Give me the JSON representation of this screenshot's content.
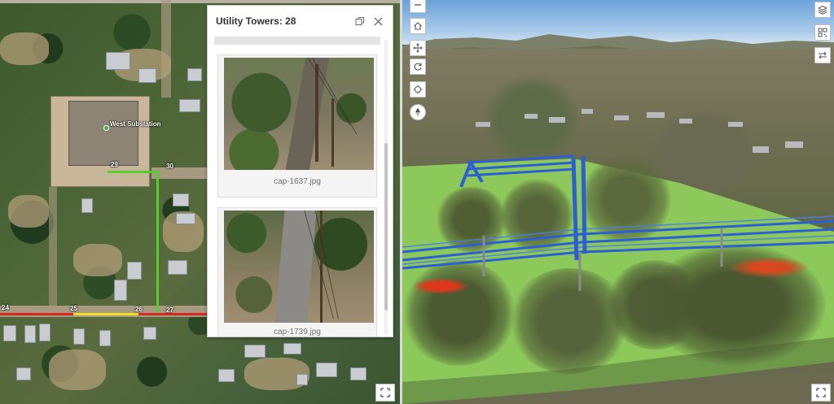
{
  "popup": {
    "title": "Utility Towers: 28",
    "dock_icon": "dock-icon",
    "close_icon": "close-icon",
    "attachments": [
      {
        "caption": "cap-1637.jpg"
      },
      {
        "caption": "cap-1739.jpg"
      }
    ]
  },
  "map2d": {
    "substation_label": "West Substation",
    "tower_labels": {
      "t29": "29",
      "t30": "30",
      "t24": "24",
      "t25": "25",
      "t26": "26",
      "t27": "27"
    },
    "expand_icon": "expand-icon"
  },
  "scene3d": {
    "nav_icons": {
      "zoom_out": "minus-icon",
      "home": "home-icon",
      "pan": "pan-icon",
      "rotate": "rotate-icon",
      "locate": "locate-icon",
      "compass": "compass-icon"
    },
    "right_tool_icons": {
      "layers": "layers-icon",
      "qr": "qr-code-icon",
      "swap": "swap-icon"
    },
    "expand_icon": "expand-icon"
  },
  "colors": {
    "line_green": "#55d02a",
    "line_red": "#d8281f",
    "line_yellow": "#f0e02a",
    "lidar_blue": "#2c5fd6",
    "ground_green": "#8cc95a"
  }
}
